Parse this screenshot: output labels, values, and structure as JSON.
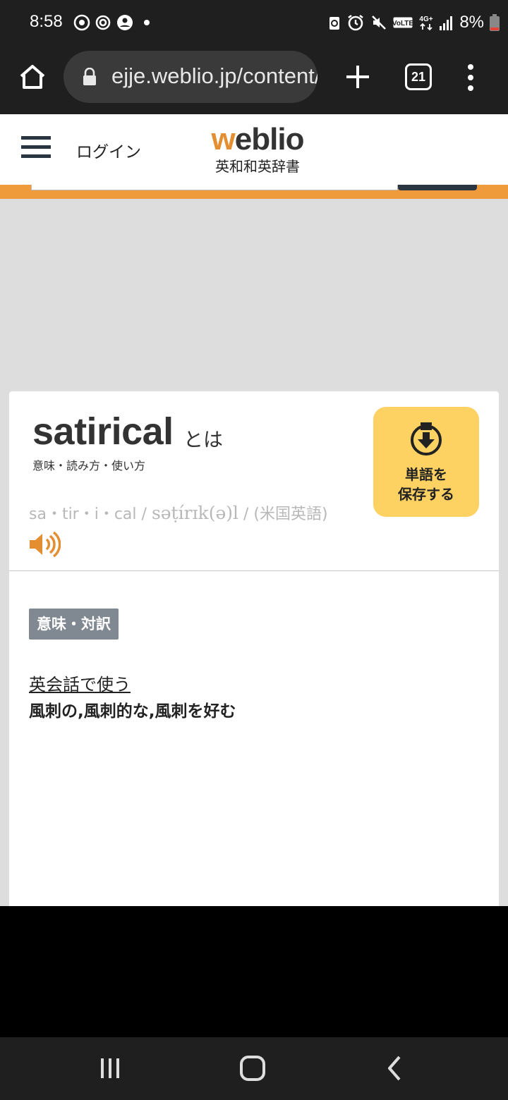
{
  "status_bar": {
    "time": "8:58",
    "battery": "8%",
    "icons": [
      "whatsapp-icon",
      "sync-icon",
      "account-icon",
      "dot-icon",
      "recycle-icon",
      "alarm-icon",
      "mute-icon",
      "volte-icon",
      "4g-icon",
      "signal-icon",
      "battery-icon"
    ],
    "volte_text": "VoLTE",
    "network_text": "4G+"
  },
  "browser": {
    "url": "ejje.weblio.jp/content/satirical",
    "tab_count": "21"
  },
  "header": {
    "login": "ログイン",
    "logo_w": "w",
    "logo_rest": "eblio",
    "logo_sub": "英和和英辞書"
  },
  "entry": {
    "word": "satirical",
    "toha": "とは",
    "sub_label": "意味・読み方・使い方",
    "save_line1": "単語を",
    "save_line2": "保存する",
    "syllables": "sa・tir・i・cal",
    "ipa": "səṭírɪk(ə)l",
    "region": "(米国英語)",
    "meaning_tag": "意味・対訳",
    "eikaiwa_link": "英会話で使う",
    "meaning": "風刺の,風刺的な,風刺を好む"
  },
  "colors": {
    "accent_orange": "#ef9a3b",
    "save_yellow": "#fdd263",
    "bar_dark": "#1f1f1f"
  }
}
